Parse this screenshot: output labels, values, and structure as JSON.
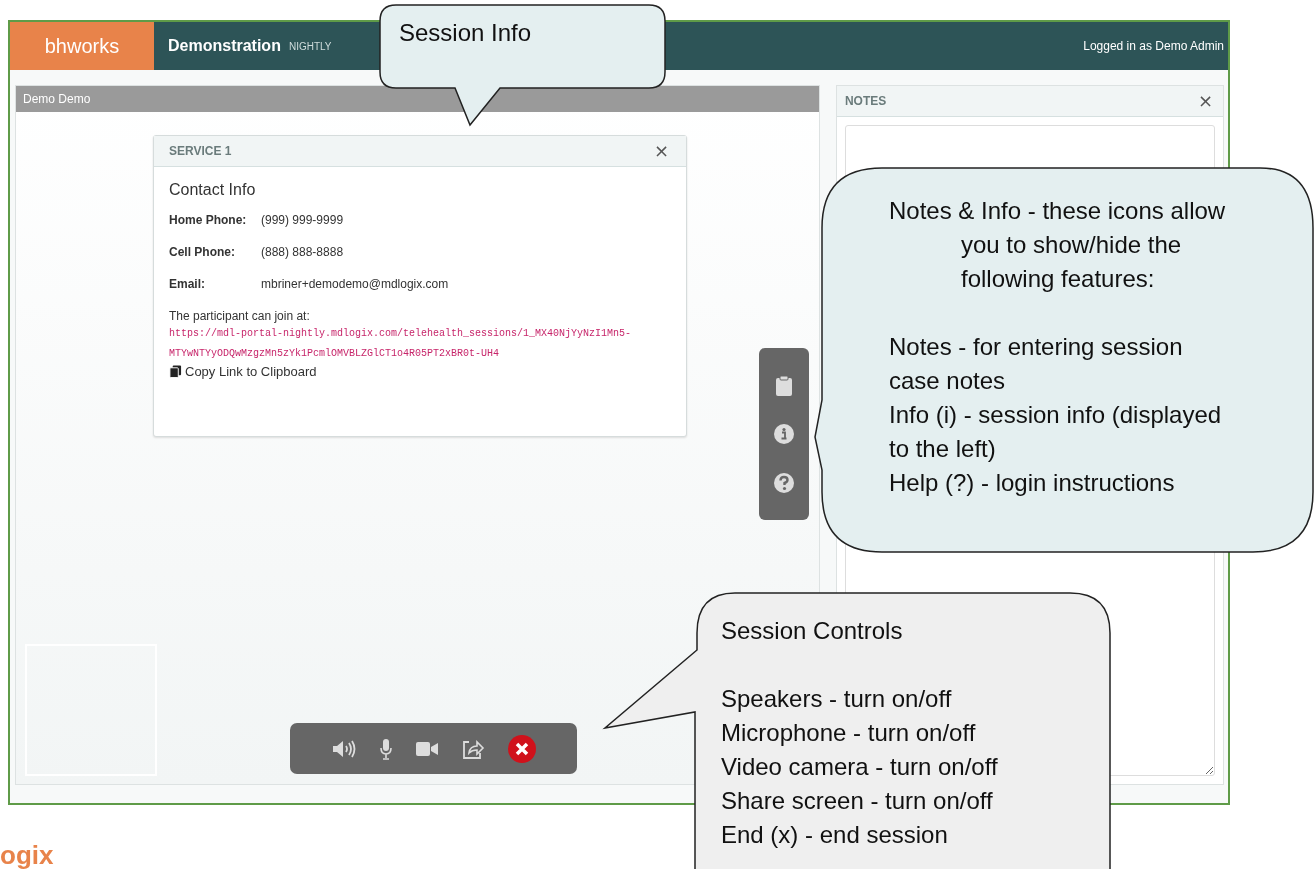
{
  "header": {
    "logo": "bh**works**",
    "title": "Demonstration",
    "badge": "NIGHTLY",
    "user": "Logged in as Demo Admin"
  },
  "session_panel": {
    "title": "Demo Demo"
  },
  "service_card": {
    "title": "SERVICE 1",
    "close": "×",
    "heading": "Contact Info",
    "fields": [
      {
        "label": "Home Phone:",
        "value": "(999) 999-9999"
      },
      {
        "label": "Cell Phone:",
        "value": "(888) 888-8888"
      },
      {
        "label": "Email:",
        "value": "mbriner+demodemo@mdlogix.com"
      }
    ],
    "join_label": "The participant can join at:",
    "link": "https://mdl-portal-nightly.mdlogix.com/telehealth_sessions/1_MX40NjYyNzI1Mn5-MTYwNTYyODQwMzgzMn5zYk1PcmlOMVBLZGlCT1o4R05PT2xBR0t-UH4",
    "copy_link": "Copy Link to Clipboard"
  },
  "notes_panel": {
    "title": "NOTES",
    "close": "×"
  },
  "callouts": [
    {
      "kind": "top",
      "blocks": [
        [
          "Session Info"
        ]
      ]
    },
    {
      "kind": "left",
      "blocks": [
        [
          "Notes & Info - these icons allow",
          "you to show/hide the",
          "following features:"
        ],
        [
          "Notes - for entering session",
          "case notes",
          "Info (i) - session info (displayed",
          "to the left)",
          "Help (?) - login instructions"
        ]
      ]
    },
    {
      "kind": "controls",
      "blocks": [
        [
          "Session Controls"
        ],
        [
          "Speakers - turn on/off",
          "Microphone - turn on/off",
          "Video camera - turn on/off",
          "Share screen - turn on/off",
          "End (x) - end session"
        ]
      ]
    }
  ],
  "footer_logo": "ogix"
}
